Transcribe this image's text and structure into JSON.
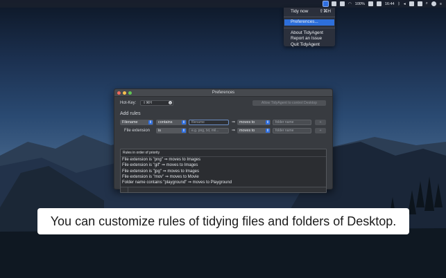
{
  "menubar": {
    "battery": "100%",
    "time": "16:44"
  },
  "menu": {
    "items": [
      {
        "label": "Tidy now",
        "shortcut": "⇧⌘H"
      },
      {
        "label": "Preferences...",
        "shortcut": ""
      },
      {
        "label": "About TidyAgent",
        "shortcut": ""
      },
      {
        "label": "Report an Issue",
        "shortcut": ""
      },
      {
        "label": "Quit TidyAgent",
        "shortcut": ""
      }
    ]
  },
  "window": {
    "title": "Preferences",
    "hotkey_label": "Hot-Key:",
    "hotkey_value": "⇧⌘H",
    "allow_button": "Allow TidyAgent to control Desktop",
    "add_rules_label": "Add rules",
    "rule1": {
      "subject": "Filename",
      "operator": "contains",
      "value_placeholder": "filename",
      "action": "moves to",
      "target_placeholder": "folder name",
      "button": "+"
    },
    "rule2": {
      "subject": "File extension",
      "operator": "is",
      "value_placeholder": "e.g. png, txt, mil...",
      "action": "moves to",
      "target_placeholder": "folder name",
      "button": "+"
    },
    "arrow": "⇒",
    "list_header": "Rules in order of priority",
    "rules": [
      "File extension is \"png\"  ⇒  moves to Images",
      "File extension is \"gif\"  ⇒  moves to Images",
      "File extension is \"jpg\"  ⇒  moves to Images",
      "File extension is \"mov\"  ⇒  moves to Movie",
      "Folder name contains \"playground\"  ⇒  moves to Playground"
    ]
  },
  "banner": {
    "text": "You can customize rules of tidying files and folders of Desktop."
  },
  "colors": {
    "accent": "#2d6fdb",
    "close": "#ed6a5e",
    "minimize": "#f5bf4f",
    "zoom": "#61c554"
  }
}
